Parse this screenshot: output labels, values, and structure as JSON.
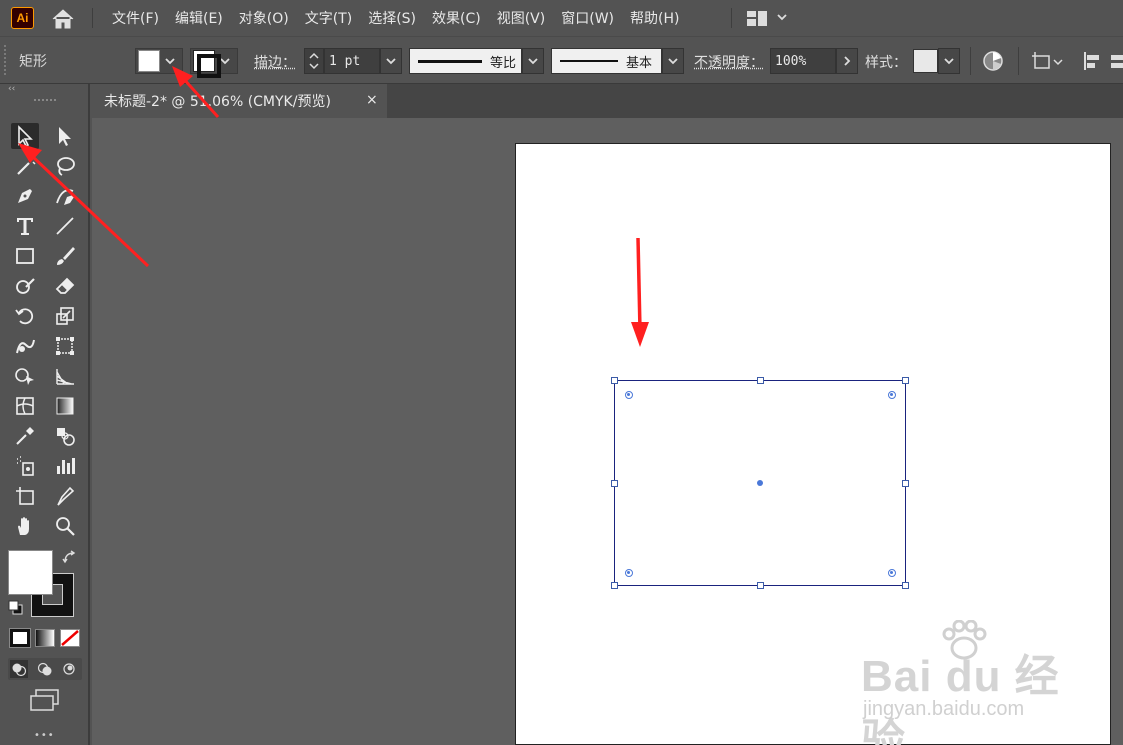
{
  "app": {
    "logo_text": "Ai",
    "menu": [
      "文件(F)",
      "编辑(E)",
      "对象(O)",
      "文字(T)",
      "选择(S)",
      "效果(C)",
      "视图(V)",
      "窗口(W)",
      "帮助(H)"
    ]
  },
  "control_bar": {
    "object_type": "矩形",
    "fill_color": "#ffffff",
    "stroke_label": "描边：",
    "stroke_weight": "1 pt",
    "profile_label": "等比",
    "brush_label": "基本",
    "opacity_label": "不透明度：",
    "opacity_value": "100%",
    "style_label": "样式："
  },
  "document": {
    "tab_title": "未标题-2* @ 51.06% (CMYK/预览)",
    "close_glyph": "×"
  },
  "toolbar": {
    "collapse_glyph": "‹‹",
    "more_glyph": "•••"
  },
  "watermark": {
    "brand": "Bai du 经验",
    "url": "jingyan.baidu.com"
  },
  "colors": {
    "annotation_arrow": "#ff2020",
    "selection_blue": "#1a237e",
    "panel_bg": "#535353",
    "canvas_bg": "#5f5f5f"
  }
}
